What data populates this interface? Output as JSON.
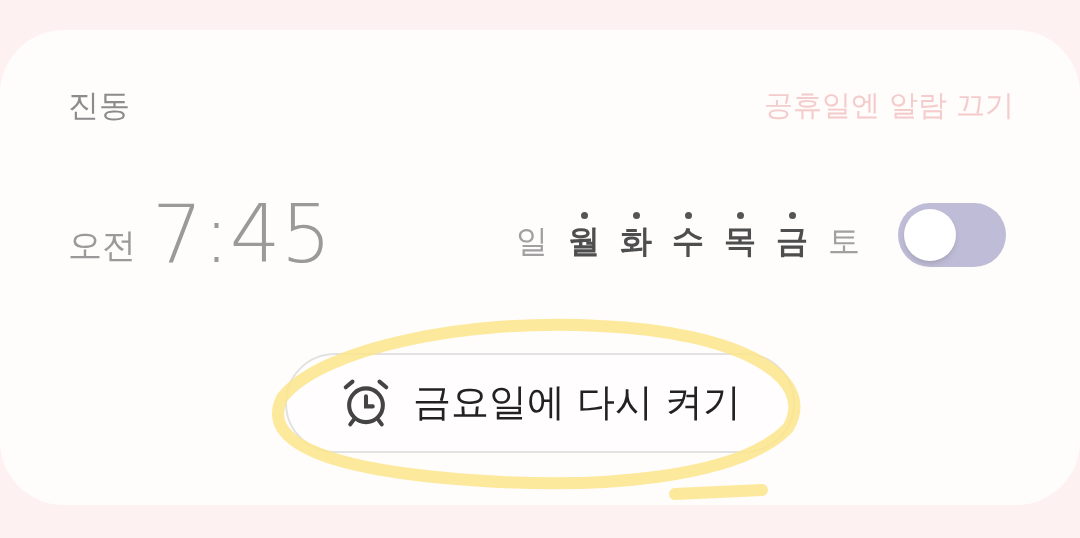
{
  "vibration_label": "진동",
  "holiday_link": "공휴일엔 알람 끄기",
  "alarm": {
    "meridiem": "오전",
    "time": "7:45"
  },
  "days": [
    {
      "label": "일",
      "selected": false
    },
    {
      "label": "월",
      "selected": true
    },
    {
      "label": "화",
      "selected": true
    },
    {
      "label": "수",
      "selected": true
    },
    {
      "label": "목",
      "selected": true
    },
    {
      "label": "금",
      "selected": true
    },
    {
      "label": "토",
      "selected": false
    }
  ],
  "toggle": {
    "on": false
  },
  "resume_button": {
    "label": "금요일에 다시 켜기"
  }
}
